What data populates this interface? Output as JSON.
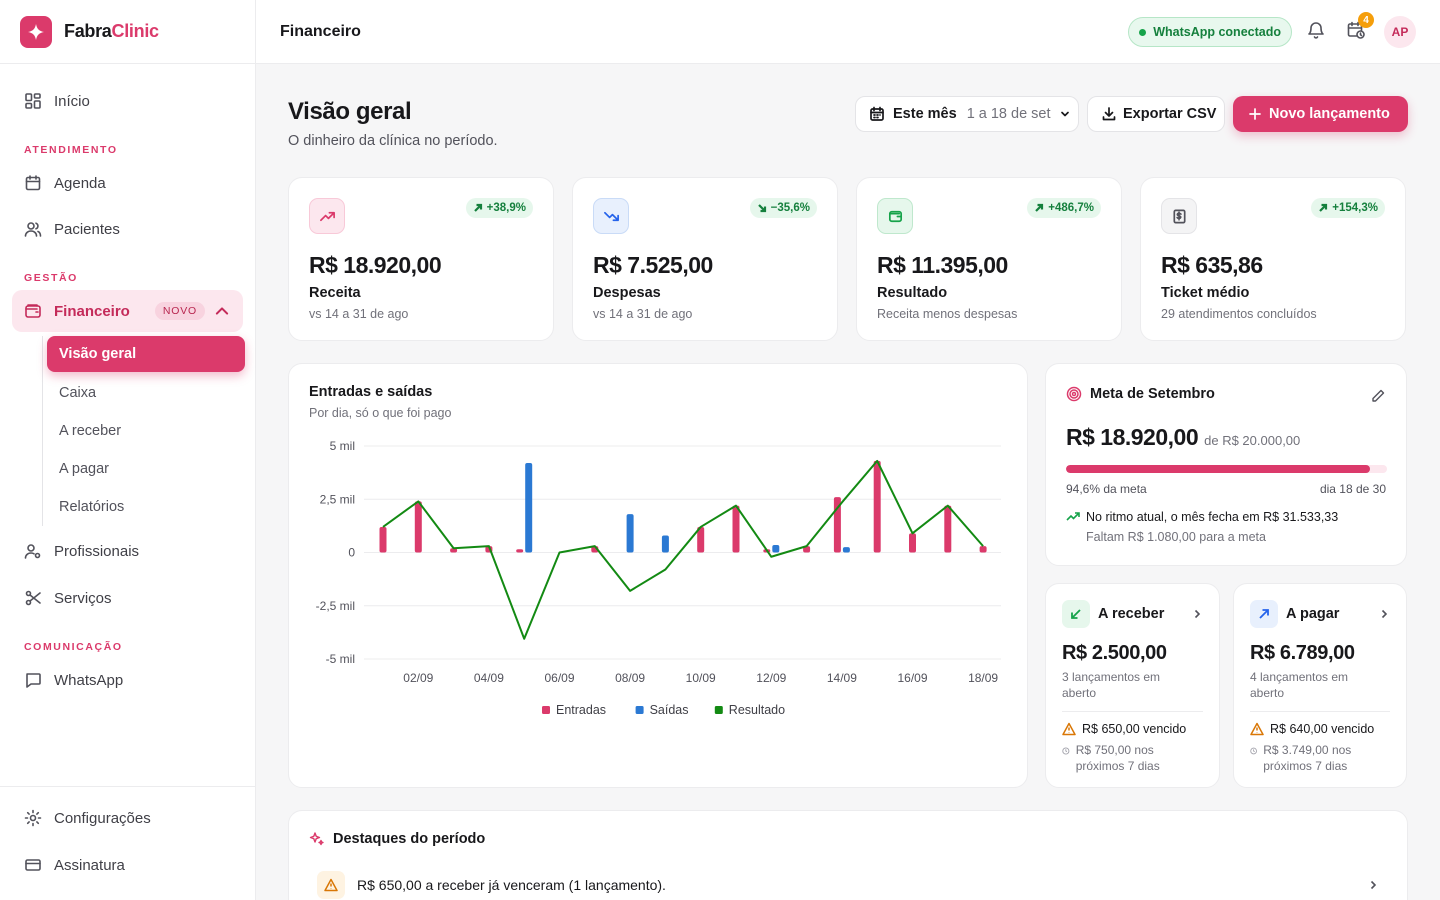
{
  "brand": {
    "name_part1": "Fabra",
    "name_part2": "Clinic"
  },
  "topbar": {
    "title": "Financeiro",
    "whatsapp_status": "WhatsApp conectado",
    "notification_count": "4",
    "avatar_initials": "AP"
  },
  "sidebar": {
    "inicio": "Início",
    "section_atendimento": "ATENDIMENTO",
    "agenda": "Agenda",
    "pacientes": "Pacientes",
    "section_gestao": "GESTÃO",
    "financeiro": "Financeiro",
    "financeiro_badge": "NOVO",
    "sub_items": [
      "Visão geral",
      "Caixa",
      "A receber",
      "A pagar",
      "Relatórios"
    ],
    "profissionais": "Profissionais",
    "servicos": "Serviços",
    "section_comunicacao": "COMUNICAÇÃO",
    "whatsapp": "WhatsApp",
    "configuracoes": "Configurações",
    "assinatura": "Assinatura"
  },
  "header": {
    "title": "Visão geral",
    "subtitle": "O dinheiro da clínica no período.",
    "period_label": "Este mês",
    "period_range": "1 a 18 de set",
    "export_label": "Exportar CSV",
    "new_label": "Novo lançamento"
  },
  "kpis": [
    {
      "value": "R$ 18.920,00",
      "label": "Receita",
      "sub": "vs 14 a 31 de ago",
      "delta": "+38,9%",
      "delta_dir": "up",
      "icon": "trending-up-icon",
      "color": "#db3a6b"
    },
    {
      "value": "R$ 7.525,00",
      "label": "Despesas",
      "sub": "vs 14 a 31 de ago",
      "delta": "−35,6%",
      "delta_dir": "down",
      "icon": "trending-down-icon",
      "color": "#2563eb"
    },
    {
      "value": "R$ 11.395,00",
      "label": "Resultado",
      "sub": "Receita menos despesas",
      "delta": "+486,7%",
      "delta_dir": "up",
      "icon": "wallet-icon",
      "color": "#16a34a"
    },
    {
      "value": "R$ 635,86",
      "label": "Ticket médio",
      "sub": "29 atendimentos concluídos",
      "delta": "+154,3%",
      "delta_dir": "up",
      "icon": "receipt-icon",
      "color": "#52525b"
    }
  ],
  "chart": {
    "title": "Entradas e saídas",
    "subtitle": "Por dia, só o que foi pago"
  },
  "chart_data": {
    "type": "bar",
    "title": "Entradas e saídas",
    "subtitle": "Por dia, só o que foi pago",
    "x": [
      "01/09",
      "02/09",
      "03/09",
      "04/09",
      "05/09",
      "06/09",
      "07/09",
      "08/09",
      "09/09",
      "10/09",
      "11/09",
      "12/09",
      "13/09",
      "14/09",
      "15/09",
      "16/09",
      "17/09",
      "18/09"
    ],
    "x_tick_labels": [
      "02/09",
      "04/09",
      "06/09",
      "08/09",
      "10/09",
      "12/09",
      "14/09",
      "16/09",
      "18/09"
    ],
    "y_tick_labels": [
      "5 mil",
      "2,5 mil",
      "0",
      "-2,5 mil",
      "-5 mil"
    ],
    "ylim": [
      -5000,
      5000
    ],
    "grid": true,
    "legend_position": "bottom",
    "series": [
      {
        "name": "Entradas",
        "kind": "bar",
        "color": "#db3a6b",
        "values": [
          1200,
          2400,
          200,
          300,
          150,
          0,
          300,
          0,
          0,
          1200,
          2200,
          150,
          300,
          2600,
          4300,
          900,
          2200,
          300
        ]
      },
      {
        "name": "Saídas",
        "kind": "bar",
        "color": "#2b79d3",
        "values": [
          0,
          0,
          0,
          0,
          4200,
          0,
          0,
          1800,
          800,
          0,
          0,
          350,
          0,
          250,
          0,
          0,
          0,
          0
        ]
      },
      {
        "name": "Resultado",
        "kind": "line",
        "color": "#138a13",
        "values": [
          1200,
          2400,
          200,
          300,
          -4050,
          0,
          300,
          -1800,
          -800,
          1200,
          2200,
          -200,
          300,
          2350,
          4300,
          900,
          2200,
          300
        ]
      }
    ]
  },
  "meta": {
    "title": "Meta de Setembro",
    "current": "R$ 18.920,00",
    "target": "de R$ 20.000,00",
    "percent_label": "94,6% da meta",
    "day_label": "dia 18 de 30",
    "progress": 0.946,
    "pace_text": "No ritmo atual, o mês fecha em R$ 31.533,33",
    "remaining_text": "Faltam R$ 1.080,00 para a meta"
  },
  "receber": {
    "title": "A receber",
    "value": "R$ 2.500,00",
    "count": "3 lançamentos em aberto",
    "overdue": "R$ 650,00 vencido",
    "upcoming": "R$ 750,00 nos próximos 7 dias"
  },
  "pagar": {
    "title": "A pagar",
    "value": "R$ 6.789,00",
    "count": "4 lançamentos em aberto",
    "overdue": "R$ 640,00 vencido",
    "upcoming": "R$ 3.749,00 nos próximos 7 dias"
  },
  "destaques": {
    "title": "Destaques do período",
    "items": [
      "R$ 650,00 a receber já venceram (1 lançamento)."
    ]
  },
  "colors": {
    "accent": "#db3a6b",
    "success": "#16a34a",
    "info": "#2b79d3",
    "warning": "#d97706"
  }
}
